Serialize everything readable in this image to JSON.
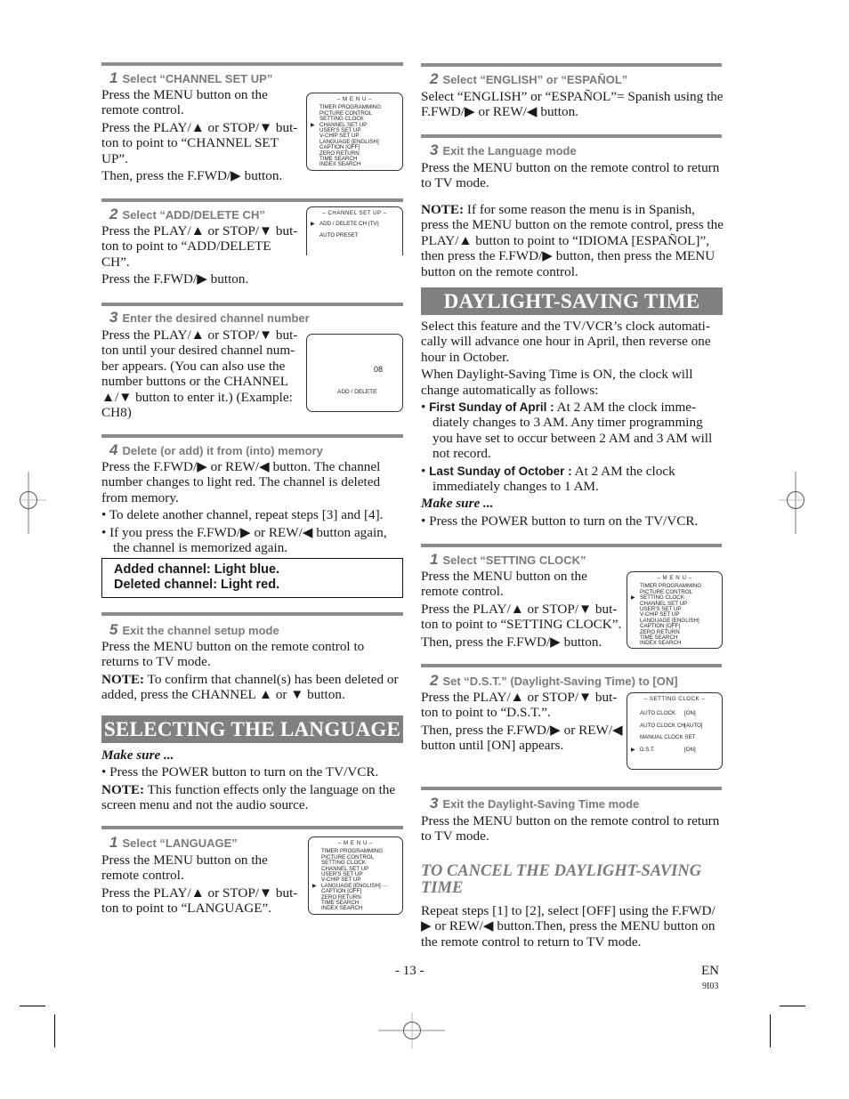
{
  "left_column": {
    "channel_steps": [
      {
        "number": "1",
        "title": "Select “CHANNEL SET UP”",
        "paragraphs": [
          "Press the MENU button on the remote control.",
          "Press the PLAY/▲ or STOP/▼ but- ton to point to “CHANNEL SET UP”.",
          "Then, press the F.FWD/▶ button."
        ],
        "screen": {
          "title": "– M E N U –",
          "items": [
            "TIMER PROGRAMMING",
            "PICTURE CONTROL",
            "SETTING CLOCK",
            "CHANNEL SET UP",
            "USER'S SET UP",
            "V-CHIP SET UP",
            "LANGUAGE  [ENGLISH]",
            "CAPTION  [OFF]",
            "ZERO RETURN",
            "TIME SEARCH",
            "INDEX SEARCH"
          ],
          "selected": "CHANNEL SET UP"
        }
      },
      {
        "number": "2",
        "title": "Select “ADD/DELETE CH”",
        "paragraphs": [
          "Press the PLAY/▲ or STOP/▼ but- ton to point to “ADD/DELETE CH”.",
          "Press the F.FWD/▶ button."
        ],
        "screen": {
          "title": "– CHANNEL SET UP –",
          "items": [
            "ADD / DELETE CH (TV)",
            "AUTO PRESET"
          ],
          "selected": "ADD / DELETE CH (TV)"
        }
      },
      {
        "number": "3",
        "title": "Enter the desired channel number",
        "paragraphs": [
          "Press the PLAY/▲ or STOP/▼ but- ton until your desired channel num- ber appears. (You can also use the number buttons  or the CHANNEL ▲/▼ button to enter it.) (Example: CH8)"
        ],
        "screen": {
          "channel": "08",
          "label": "ADD / DELETE"
        }
      },
      {
        "number": "4",
        "title": "Delete (or add) it from (into) memory",
        "paragraphs": [
          "Press the F.FWD/▶ or REW/◀ button. The channel number changes to light red. The channel is deleted from memory."
        ],
        "bullets": [
          "To delete another channel, repeat steps [3] and [4].",
          "If you press the F.FWD/▶ or REW/◀ button again, the channel is memorized again."
        ],
        "notebox": [
          "Added channel: Light blue.",
          "Deleted channel: Light red."
        ]
      },
      {
        "number": "5",
        "title": "Exit the channel setup mode",
        "paragraphs": [
          "Press the MENU button on the remote control to returns to TV mode."
        ],
        "note_label": "NOTE:",
        "note_text": " To confirm that channel(s) has been deleted or added, press the CHANNEL ▲ or ▼ button."
      }
    ],
    "language_section": {
      "banner": "SELECTING THE LANGUAGE",
      "make_sure": "Make sure ...",
      "make_sure_bullet": "Press the POWER button to turn on the TV/VCR.",
      "note_label": "NOTE:",
      "note_text": " This function effects only the language on the screen menu and not the audio source.",
      "step1": {
        "number": "1",
        "title": "Select “LANGUAGE”",
        "paragraphs": [
          "Press the MENU button on the remote control.",
          "Press the PLAY/▲ or STOP/▼ but- ton to point to “LANGUAGE”."
        ],
        "screen": {
          "title": "– M E N U –",
          "items": [
            "TIMER PROGRAMMING",
            "PICTURE CONTROL",
            "SETTING CLOCK",
            "CHANNEL SET UP",
            "USER'S SET UP",
            "V-CHIP SET UP",
            "LANGUAGE  [ENGLISH]",
            "CAPTION  [OFF]",
            "ZERO RETURN",
            "TIME SEARCH",
            "INDEX SEARCH"
          ],
          "selected": "LANGUAGE  [ENGLISH]"
        }
      }
    }
  },
  "right_column": {
    "language_step2": {
      "number": "2",
      "title": "Select “ENGLISH” or “ESPAÑOL”",
      "text": "Select “ENGLISH” or “ESPAÑOL”= Spanish using the F.FWD/▶ or REW/◀ button."
    },
    "language_step3": {
      "number": "3",
      "title": "Exit the Language mode",
      "text": "Press the MENU button on the remote control to return to TV mode."
    },
    "spanish_note": {
      "label": "NOTE:",
      "text": " If for some reason the menu is in Spanish, press the MENU button on the remote control, press the PLAY/▲ button to point to “IDIOMA [ESPAÑOL]”, then press the F.FWD/▶ button, then press the MENU button on the remote control."
    },
    "dst_section": {
      "banner": "DAYLIGHT-SAVING TIME",
      "intro1": "Select this feature and the TV/VCR’s clock automati- cally will advance one hour in April, then reverse one hour in October.",
      "intro2": "When Daylight-Saving Time is ON, the clock will change automatically as follows:",
      "bullets": [
        {
          "label": "First Sunday of April :",
          "text": " At 2 AM the clock imme- diately changes to 3 AM. Any timer programming you have set to occur between 2 AM and 3 AM will not record."
        },
        {
          "label": "Last Sunday of October :",
          "text": " At 2 AM the clock immediately changes to 1 AM."
        }
      ],
      "make_sure": "Make sure ...",
      "make_sure_bullet": "Press the POWER button to turn on the TV/VCR.",
      "step1": {
        "number": "1",
        "title": "Select “SETTING CLOCK”",
        "paragraphs": [
          "Press the MENU button on the remote control.",
          "Press the PLAY/▲ or STOP/▼ but- ton to point to “SETTING CLOCK”.",
          "Then, press the F.FWD/▶ button."
        ],
        "screen": {
          "title": "– M E N U –",
          "items": [
            "TIMER PROGRAMMING",
            "PICTURE CONTROL",
            "SETTING CLOCK",
            "CHANNEL SET UP",
            "USER'S SET UP",
            "V-CHIP SET UP",
            "LANGUAGE  [ENGLISH]",
            "CAPTION  [OFF]",
            "ZERO RETURN",
            "TIME SEARCH",
            "INDEX SEARCH"
          ],
          "selected": "SETTING CLOCK"
        }
      },
      "step2": {
        "number": "2",
        "title": "Set “D.S.T.” (Daylight-Saving Time) to [ON]",
        "paragraphs": [
          "Press the PLAY/▲ or STOP/▼ but- ton to point to “D.S.T.”.",
          "Then, press the F.FWD/▶ or REW/◀ button until [ON] appears."
        ],
        "screen": {
          "title": "– SETTING CLOCK –",
          "rows": [
            {
              "label": "AUTO CLOCK",
              "value": "[ON]"
            },
            {
              "label": "AUTO CLOCK CH",
              "value": "[AUTO]"
            },
            {
              "label": "MANUAL CLOCK SET",
              "value": ""
            },
            {
              "label": "D.S.T.",
              "value": "[ON]"
            }
          ],
          "selected": "D.S.T."
        }
      },
      "step3": {
        "number": "3",
        "title": "Exit the Daylight-Saving Time mode",
        "text": "Press the MENU button on the remote control to return to TV mode."
      },
      "cancel": {
        "title": "TO CANCEL THE DAYLIGHT-SAVING TIME",
        "text": "Repeat steps [1] to [2], select [OFF] using the F.FWD/▶ or REW/◀ button.Then, press the MENU button on the remote control to return to TV mode."
      }
    }
  },
  "footer": {
    "page_number": "- 13 -",
    "language_code": "EN",
    "doc_code": "9I03"
  },
  "colors": {
    "banner_bg": "#808080",
    "rule": "#8c8c8c",
    "step_heading": "#7a7a7a"
  }
}
